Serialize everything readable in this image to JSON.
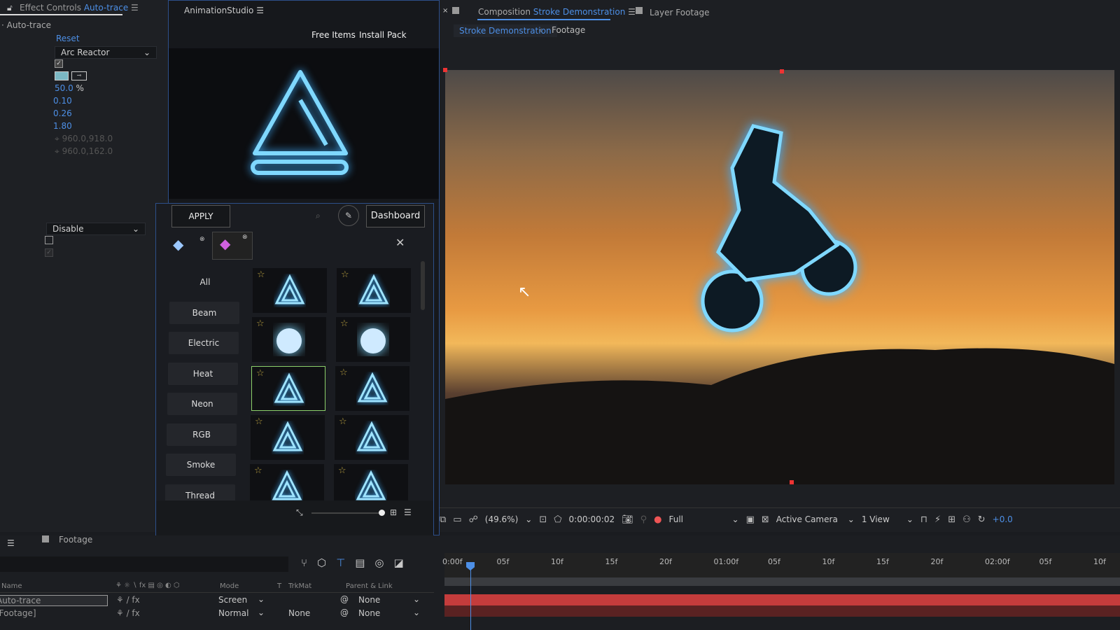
{
  "effect_controls": {
    "tab_label": "Effect Controls",
    "layer": "Auto-trace",
    "effect_name": "Auto-trace",
    "reset": "Reset",
    "preset": "Arc Reactor",
    "percent": "50.0",
    "percent_unit": "%",
    "v1": "0.10",
    "v2": "0.26",
    "v3": "1.80",
    "point1": "960.0,918.0",
    "point2": "960.0,162.0",
    "mode": "Disable"
  },
  "studio": {
    "title": "AnimationStudio",
    "free_items": "Free Items",
    "install_pack": "Install Pack",
    "apply": "APPLY",
    "dashboard": "Dashboard",
    "categories": [
      "All",
      "Beam",
      "Electric",
      "Heat",
      "Neon",
      "RGB",
      "Smoke",
      "Thread"
    ],
    "selected_thumbnail": 4
  },
  "composition": {
    "close": "×",
    "tab_prefix": "Composition",
    "tab_name": "Stroke Demonstration",
    "layer_tab": "Layer Footage",
    "breadcrumb": [
      "Stroke Demonstration",
      "Footage"
    ],
    "zoom": "(49.6%)",
    "timecode": "0:00:00:02",
    "resolution": "Full",
    "camera": "Active Camera",
    "views": "1 View",
    "exposure": "+0.0"
  },
  "timeline": {
    "comp_tab": "Footage",
    "columns": {
      "name": "Name",
      "mode": "Mode",
      "t": "T",
      "trkmat": "TrkMat",
      "parent": "Parent & Link"
    },
    "layers": [
      {
        "name": "Auto-trace",
        "mode": "Screen",
        "trkmat": "",
        "parent": "None"
      },
      {
        "name": "[Footage]",
        "mode": "Normal",
        "trkmat": "None",
        "parent": "None"
      }
    ],
    "ruler": [
      "0:00f",
      "05f",
      "10f",
      "15f",
      "20f",
      "01:00f",
      "05f",
      "10f",
      "15f",
      "20f",
      "02:00f",
      "05f",
      "10f"
    ]
  },
  "colors": {
    "accent": "#4d8fe6",
    "glow": "#7fd8ff",
    "layer_bar": "#c43c3c"
  }
}
